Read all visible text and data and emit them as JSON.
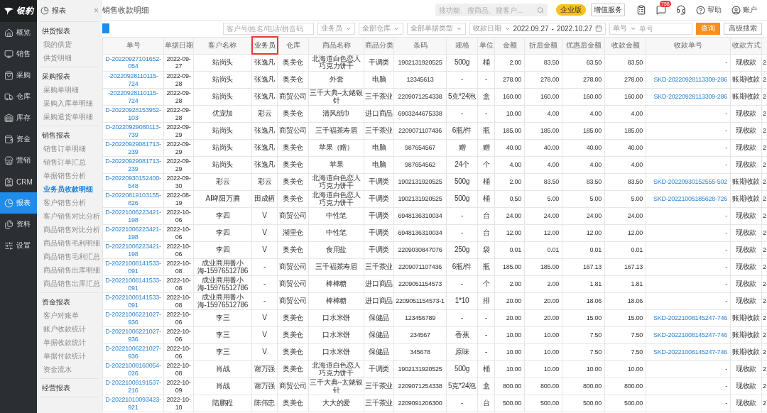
{
  "sidebar": {
    "logo_text": "银豹",
    "items": [
      {
        "label": "概览",
        "selected": false
      },
      {
        "label": "销售",
        "selected": false
      },
      {
        "label": "采购",
        "selected": false
      },
      {
        "label": "仓库",
        "selected": false
      },
      {
        "label": "库存",
        "selected": false
      },
      {
        "label": "资金",
        "selected": false
      },
      {
        "label": "营销",
        "selected": false
      },
      {
        "label": "CRM",
        "selected": false
      },
      {
        "label": "报表",
        "selected": true
      },
      {
        "label": "资料",
        "selected": false
      },
      {
        "label": "设置",
        "selected": false
      }
    ]
  },
  "submenu": {
    "title": "报表",
    "close": "×",
    "groups": [
      {
        "title": "供货报表",
        "items": [
          {
            "label": "我的供货",
            "selected": false
          },
          {
            "label": "供货明细",
            "selected": false
          }
        ]
      },
      {
        "title": "采购报表",
        "items": [
          {
            "label": "采购单明细",
            "selected": false
          },
          {
            "label": "采购入库单明细",
            "selected": false
          },
          {
            "label": "采购退货单明细",
            "selected": false
          }
        ]
      },
      {
        "title": "销售报表",
        "items": [
          {
            "label": "销售订单明细",
            "selected": false
          },
          {
            "label": "销售订单汇总",
            "selected": false
          },
          {
            "label": "单据销售分析",
            "selected": false
          },
          {
            "label": "业务员收款明细",
            "selected": true
          },
          {
            "label": "客户销售分析",
            "selected": false
          },
          {
            "label": "客户销售对比分析",
            "selected": false
          },
          {
            "label": "商品销售对比分析",
            "selected": false
          },
          {
            "label": "商品销售毛利明细",
            "selected": false
          },
          {
            "label": "商品销售毛利汇总",
            "selected": false
          },
          {
            "label": "商品销售出库明细",
            "selected": false
          },
          {
            "label": "商品销售出库汇总",
            "selected": false
          }
        ]
      },
      {
        "title": "资金报表",
        "items": [
          {
            "label": "客户对账单",
            "selected": false
          },
          {
            "label": "账户收款统计",
            "selected": false
          },
          {
            "label": "单据收款统计",
            "selected": false
          },
          {
            "label": "单据付款统计",
            "selected": false
          },
          {
            "label": "资金流水",
            "selected": false
          }
        ]
      },
      {
        "title": "经营报表"
      }
    ]
  },
  "header": {
    "title": "销售收款明细",
    "search": {
      "placeholder": "搜功能、搜商品、搜客户..."
    },
    "edition_badge": "企业版",
    "service_button": "增值服务",
    "message_count": "758",
    "help": "帮助",
    "account": "账户"
  },
  "filters": {
    "customer": {
      "placeholder": "客户号/姓名/电话/拼音码"
    },
    "selects": [
      {
        "label": "业务员"
      },
      {
        "label": "全部仓库"
      },
      {
        "label": "全部单据类型"
      }
    ],
    "date_range": {
      "type_label": "收款日期",
      "start": "2022.09.27",
      "separator": "-",
      "end": "2022.10.27"
    },
    "number": {
      "type_label": "单号",
      "placeholder": "单号"
    },
    "buttons": [
      {
        "label": "查询",
        "kind": "primary"
      },
      {
        "label": "高级搜索",
        "kind": "default"
      }
    ]
  },
  "table": {
    "columns": [
      {
        "label": "单号",
        "kind": "link",
        "highlighted": false
      },
      {
        "label": "单据日期",
        "kind": "code",
        "highlighted": false
      },
      {
        "label": "客户名称",
        "kind": "text",
        "highlighted": false
      },
      {
        "label": "业务员",
        "kind": "text",
        "highlighted": true
      },
      {
        "label": "仓库",
        "kind": "text",
        "highlighted": false
      },
      {
        "label": "商品名称",
        "kind": "text",
        "highlighted": false
      },
      {
        "label": "商品分类",
        "kind": "text",
        "highlighted": false
      },
      {
        "label": "条码",
        "kind": "code",
        "highlighted": false
      },
      {
        "label": "规格",
        "kind": "text",
        "highlighted": false
      },
      {
        "label": "单位",
        "kind": "text",
        "highlighted": false
      },
      {
        "label": "金额",
        "kind": "number",
        "highlighted": false
      },
      {
        "label": "折后金额",
        "kind": "number",
        "highlighted": false
      },
      {
        "label": "优惠后金额",
        "kind": "number",
        "highlighted": false
      },
      {
        "label": "收款金额",
        "kind": "number",
        "highlighted": false
      },
      {
        "label": "收款单号",
        "kind": "receipt",
        "highlighted": false
      },
      {
        "label": "收款方式",
        "kind": "text",
        "highlighted": false
      },
      {
        "kind": "edge",
        "highlighted": false
      }
    ],
    "rows": [
      {
        "linked": false,
        "cells": [
          "D-20220927101652-054",
          "2022-09-27",
          "站岗头",
          "张逸凡",
          "奥美仓",
          "北海道白色恋人巧克力饼干",
          "干调类",
          "1902131920525",
          "500g",
          "桶",
          "2.00",
          "83.50",
          "83.50",
          "83.50",
          "-",
          "现收款",
          "2"
        ]
      },
      {
        "linked": true,
        "cells": [
          "-20220928110115-724",
          "2022-09-28",
          "站岗头",
          "张逸凡",
          "奥美仓",
          "外套",
          "电脑",
          "12345613",
          "-",
          "-",
          "278.00",
          "278.00",
          "278.00",
          "278.00",
          "SKD-20220928113309-286",
          "账期收款",
          "2"
        ]
      },
      {
        "linked": true,
        "cells": [
          "-20220928110115-724",
          "2022-09-28",
          "站岗头",
          "张逸凡",
          "商贸公司",
          "三千大典--太姥银针",
          "三千茶业",
          "2209071254338",
          "5克*24泡",
          "盒",
          "160.00",
          "160.00",
          "160.00",
          "160.00",
          "SKD-20220928113309-286",
          "账期收款",
          "2"
        ]
      },
      {
        "linked": false,
        "cells": [
          "D-20220928153952-103",
          "2022-09-28",
          "优宠加",
          "彩云",
          "奥美仓",
          "清风纸巾",
          "进口商品",
          "6903244675338",
          "-",
          "-",
          "10.00",
          "4.00",
          "4.00",
          "4.00",
          "-",
          "现收款",
          "2"
        ]
      },
      {
        "linked": false,
        "cells": [
          "D-20220929080113-739",
          "2022-09-29",
          "站岗头",
          "张逸凡",
          "商贸公司",
          "三千福茶寿眉",
          "三千茶业",
          "2209071107436",
          "6瓶/件",
          "瓶",
          "185.00",
          "185.00",
          "185.00",
          "185.00",
          "-",
          "现收款",
          "2"
        ]
      },
      {
        "linked": false,
        "cells": [
          "D-20220929081713-239",
          "2022-09-29",
          "站岗头",
          "张逸凡",
          "奥美仓",
          "苹果（赠）",
          "电脑",
          "987654567",
          "赠",
          "赠",
          "40.00",
          "40.00",
          "40.00",
          "40.00",
          "-",
          "现收款",
          "2"
        ]
      },
      {
        "linked": false,
        "cells": [
          "D-20220929081713-239",
          "2022-09-29",
          "站岗头",
          "张逸凡",
          "奥美仓",
          "苹果",
          "电脑",
          "987654562",
          "24个",
          "个",
          "4.00",
          "4.00",
          "4.00",
          "4.00",
          "-",
          "现收款",
          "2"
        ]
      },
      {
        "linked": true,
        "cells": [
          "D-20220930152400-548",
          "2022-09-30",
          "彩云",
          "彩云",
          "奥美仓",
          "北海道白色恋人巧克力饼干",
          "干调类",
          "1902131920525",
          "500g",
          "桶",
          "2.00",
          "83.50",
          "83.50",
          "83.50",
          "SKD-20220930152555-502",
          "账期收款",
          "2"
        ]
      },
      {
        "linked": true,
        "cells": [
          "D-20220819103155-826",
          "2022-08-19",
          "AI啤阳万腾",
          "田成栖",
          "奥美仓",
          "北海道白色恋人巧克力饼干",
          "干调类",
          "1902131920525",
          "500g",
          "桶",
          "0.50",
          "5.00",
          "5.00",
          "5.00",
          "SKD-20221005185628-726",
          "账期收款",
          "2"
        ]
      },
      {
        "linked": false,
        "cells": [
          "D-20221006223421-198",
          "2022-10-06",
          "李四",
          "V",
          "商贸公司",
          "中性笔",
          "干调类",
          "6948136310034",
          "-",
          "台",
          "24.00",
          "24.00",
          "24.00",
          "24.00",
          "-",
          "现收款",
          "2"
        ]
      },
      {
        "linked": false,
        "cells": [
          "D-20221006223421-198",
          "2022-10-06",
          "李四",
          "V",
          "湖里仓",
          "中性笔",
          "干调类",
          "6948136310034",
          "-",
          "台",
          "12.00",
          "12.00",
          "12.00",
          "12.00",
          "-",
          "现收款",
          "2"
        ]
      },
      {
        "linked": false,
        "cells": [
          "D-20221006223421-198",
          "2022-10-06",
          "李四",
          "V",
          "奥美仓",
          "食用盐",
          "干调类",
          "2209030847076",
          "250g",
          "袋",
          "0.01",
          "0.01",
          "0.01",
          "0.01",
          "-",
          "现收款",
          "2"
        ]
      },
      {
        "linked": false,
        "cells": [
          "D-20221008141533-091",
          "2022-10-08",
          "成业商用番小海-15976512786",
          "-",
          "商贸公司",
          "三千福茶寿眉",
          "三千茶业",
          "2209071107436",
          "6瓶/件",
          "瓶",
          "185.00",
          "185.00",
          "167.13",
          "167.13",
          "-",
          "现收款",
          "2"
        ]
      },
      {
        "linked": false,
        "cells": [
          "D-20221008141533-091",
          "2022-10-08",
          "成业商用番小海-15976512786",
          "-",
          "商贸公司",
          "棒棒糖",
          "进口商品",
          "2209051154573",
          "-",
          "个",
          "2.00",
          "2.00",
          "1.81",
          "1.81",
          "-",
          "现收款",
          "2"
        ]
      },
      {
        "linked": false,
        "cells": [
          "D-20221008141533-091",
          "2022-10-08",
          "成业商用番小海-15976512786",
          "-",
          "商贸公司",
          "棒棒糖",
          "进口商品",
          "2209051154573-1",
          "1*10",
          "排",
          "20.00",
          "20.00",
          "18.06",
          "18.06",
          "-",
          "现收款",
          "2"
        ]
      },
      {
        "linked": true,
        "cells": [
          "D-20221006221027-936",
          "2022-10-06",
          "李三",
          "V",
          "奥美仓",
          "口水米饼",
          "保健品",
          "123456789",
          "-",
          "-",
          "20.00",
          "20.00",
          "15.00",
          "15.00",
          "SKD-20221008145247-746",
          "账期收款",
          "2"
        ]
      },
      {
        "linked": true,
        "cells": [
          "D-20221006221027-936",
          "2022-10-06",
          "李三",
          "V",
          "奥美仓",
          "口水米饼",
          "保健品",
          "234567",
          "香蕉",
          "-",
          "10.00",
          "10.00",
          "7.50",
          "7.50",
          "SKD-20221008145247-746",
          "账期收款",
          "2"
        ]
      },
      {
        "linked": true,
        "cells": [
          "D-20221006221027-936",
          "2022-10-06",
          "李三",
          "V",
          "奥美仓",
          "口水米饼",
          "保健品",
          "345678",
          "原味",
          "-",
          "10.00",
          "10.00",
          "7.50",
          "7.50",
          "SKD-20221008145247-746",
          "账期收款",
          "2"
        ]
      },
      {
        "linked": false,
        "cells": [
          "D-20221008160054-026",
          "2022-10-08",
          "肖战",
          "谢万强",
          "奥美仓",
          "北海道白色恋人巧克力饼干",
          "干调类",
          "1902131920525",
          "500g",
          "桶",
          "10.00",
          "10.00",
          "10.00",
          "10.00",
          "-",
          "现收款",
          "2"
        ]
      },
      {
        "linked": false,
        "cells": [
          "D-20221009191537-216",
          "2022-10-09",
          "肖战",
          "谢万强",
          "商贸公司",
          "三千大典--太姥银针",
          "三千茶业",
          "2209071254338",
          "5克*24泡",
          "盒",
          "800.00",
          "800.00",
          "800.00",
          "800.00",
          "-",
          "现收款",
          "2"
        ]
      },
      {
        "linked": false,
        "cells": [
          "D-20221010093423-921",
          "2022-10-10",
          "陆鹏程",
          "陈伟忠",
          "奥美仓",
          "大大的爱",
          "三千茶业",
          "2209091206300",
          "-",
          "台",
          "500.00",
          "500.00",
          "500.00",
          "500.00",
          "-",
          "现收款",
          "2"
        ]
      }
    ]
  }
}
